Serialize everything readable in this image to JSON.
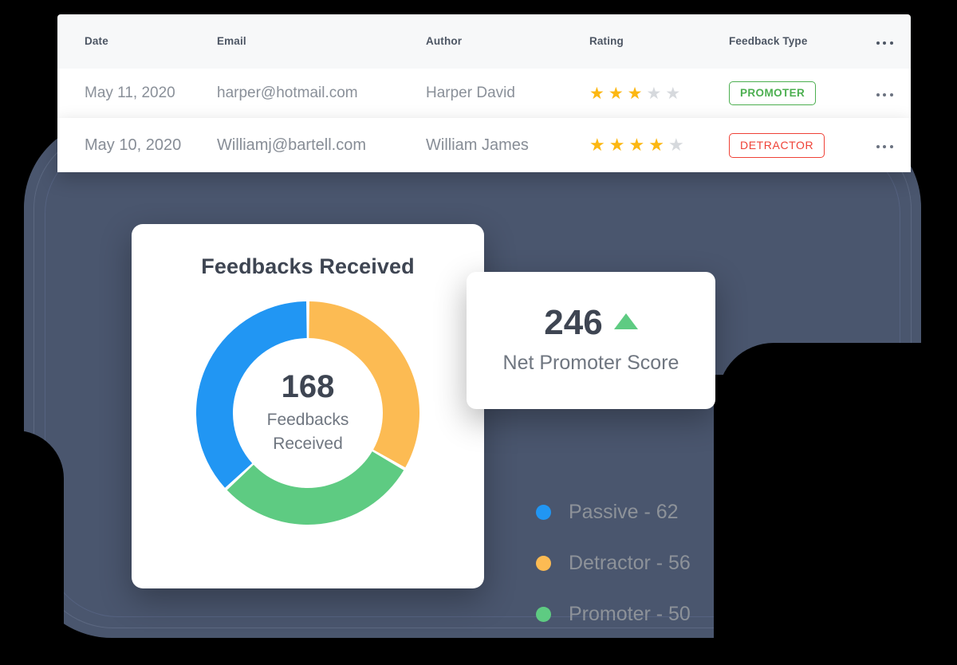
{
  "table": {
    "columns": [
      "Date",
      "Email",
      "Author",
      "Rating",
      "Feedback Type"
    ],
    "more_icon": "ellipsis-icon",
    "rows": [
      {
        "date": "May 11, 2020",
        "email": "harper@hotmail.com",
        "author": "Harper David",
        "rating": 3,
        "rating_max": 5,
        "feedback_type": "PROMOTER",
        "feedback_type_color": "#4caf50"
      },
      {
        "date": "May 10, 2020",
        "email": "Williamj@bartell.com",
        "author": "William James",
        "rating": 4,
        "rating_max": 5,
        "feedback_type": "DETRACTOR",
        "feedback_type_color": "#ef4136"
      }
    ]
  },
  "feedbacks_card": {
    "title": "Feedbacks Received",
    "center_value": "168",
    "center_label_line1": "Feedbacks",
    "center_label_line2": "Received"
  },
  "nps_card": {
    "value": "246",
    "trend": "up",
    "trend_color": "#5ecb82",
    "caption": "Net Promoter Score"
  },
  "legend": {
    "items": [
      {
        "label": "Passive - 62",
        "color": "#2196f3"
      },
      {
        "label": "Detractor - 56",
        "color": "#fcbb53"
      },
      {
        "label": "Promoter - 50",
        "color": "#5ecb82"
      }
    ]
  },
  "chart_data": {
    "type": "pie",
    "title": "Feedbacks Received",
    "total": 168,
    "categories": [
      "Detractor",
      "Promoter",
      "Passive"
    ],
    "values": [
      56,
      50,
      62
    ],
    "colors": [
      "#fcbb53",
      "#5ecb82",
      "#2196f3"
    ],
    "legend_position": "right",
    "donut": true,
    "start_angle_deg": 0,
    "labels": [
      "Detractor - 56",
      "Promoter - 50",
      "Passive - 62"
    ]
  },
  "colors": {
    "backdrop": "#4a566e",
    "star_on": "#fcb712",
    "star_off": "#d6d9dd",
    "text_dark": "#3e4552",
    "text_muted": "#8a9099"
  }
}
